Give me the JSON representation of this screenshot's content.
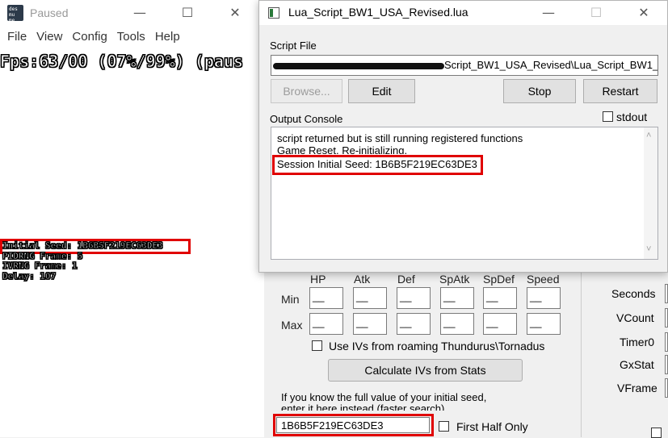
{
  "emulator": {
    "title": "Paused",
    "icon_text": "des mu me",
    "window_buttons": {
      "minimize": "—",
      "maximize": "☐",
      "close": "✕"
    },
    "menu": [
      "File",
      "View",
      "Config",
      "Tools",
      "Help"
    ],
    "overlay": {
      "fps": "Fps:63/00 (07%/99%) (paus",
      "lines": [
        "Initial Seed: 1B6B5F219EC63DE3",
        "PIDRNG Frame: 5",
        "IVRNG  Frame: 1",
        "Delay: 107"
      ]
    }
  },
  "lua_window": {
    "title": "Lua_Script_BW1_USA_Revised.lua",
    "window_buttons": {
      "minimize": "—",
      "maximize": "☐",
      "close": "✕"
    },
    "script_file_label": "Script File",
    "script_path": "Script_BW1_USA_Revised\\Lua_Script_BW1_US",
    "buttons": {
      "browse": "Browse...",
      "edit": "Edit",
      "stop": "Stop",
      "restart": "Restart"
    },
    "stdout_label": "stdout",
    "output_console_label": "Output Console",
    "console_lines": [
      "script returned but is still running registered functions",
      "Game Reset, Re-initializing.",
      "Session Initial Seed: 1B6B5F219EC63DE3"
    ],
    "scroll_up": "˄",
    "scroll_down": "˅"
  },
  "calculator": {
    "stat_headers": [
      "HP",
      "Atk",
      "Def",
      "SpAtk",
      "SpDef",
      "Speed"
    ],
    "min_label": "Min",
    "max_label": "Max",
    "iv_placeholder": "__",
    "roaming_label": "Use IVs from roaming Thundurus\\Tornadus",
    "calculate_button": "Calculate IVs from Stats",
    "seed_hint_line1": "If you know the full value of your initial seed,",
    "seed_hint_line2": "enter it here instead (faster search)",
    "seed_value": "1B6B5F219EC63DE3",
    "first_half_label": "First Half Only",
    "right_labels": [
      "Seconds",
      "VCount",
      "Timer0",
      "GxStat",
      "VFrame"
    ]
  },
  "colors": {
    "highlight": "#e00000"
  }
}
